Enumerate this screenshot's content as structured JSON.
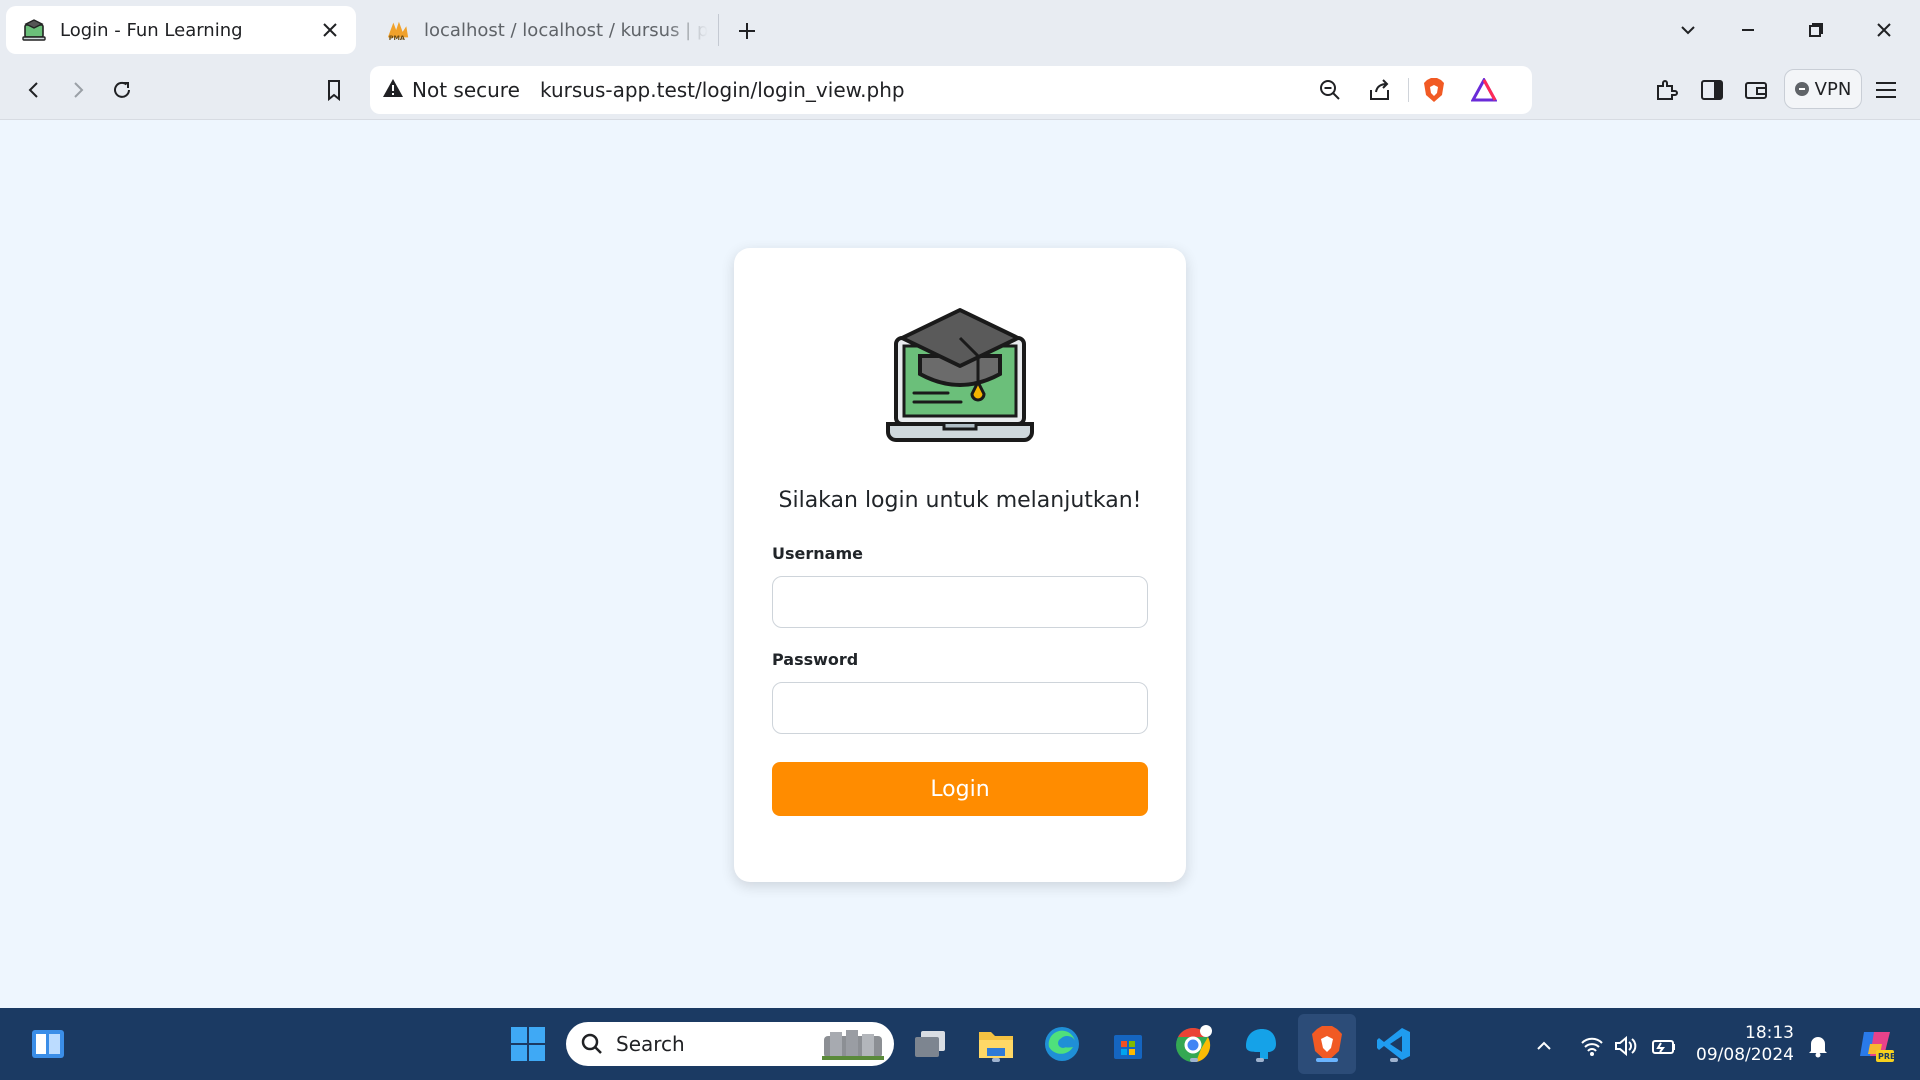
{
  "browser": {
    "tabs": [
      {
        "title": "Login - Fun Learning",
        "active": true,
        "favicon": "graduation-laptop-icon"
      },
      {
        "title": "localhost / localhost / kursus | phpMyAdmin",
        "active": false,
        "favicon": "phpmyadmin-icon"
      }
    ],
    "security_label": "Not secure",
    "url": "kursus-app.test/login/login_view.php",
    "vpn_label": "VPN"
  },
  "page": {
    "prompt": "Silakan login untuk melanjutkan!",
    "username_label": "Username",
    "username_value": "",
    "password_label": "Password",
    "password_value": "",
    "login_button": "Login",
    "accent_color": "#ff8c00",
    "background_color": "#eef6fe"
  },
  "taskbar": {
    "search_placeholder": "Search",
    "time": "18:13",
    "date": "09/08/2024"
  }
}
